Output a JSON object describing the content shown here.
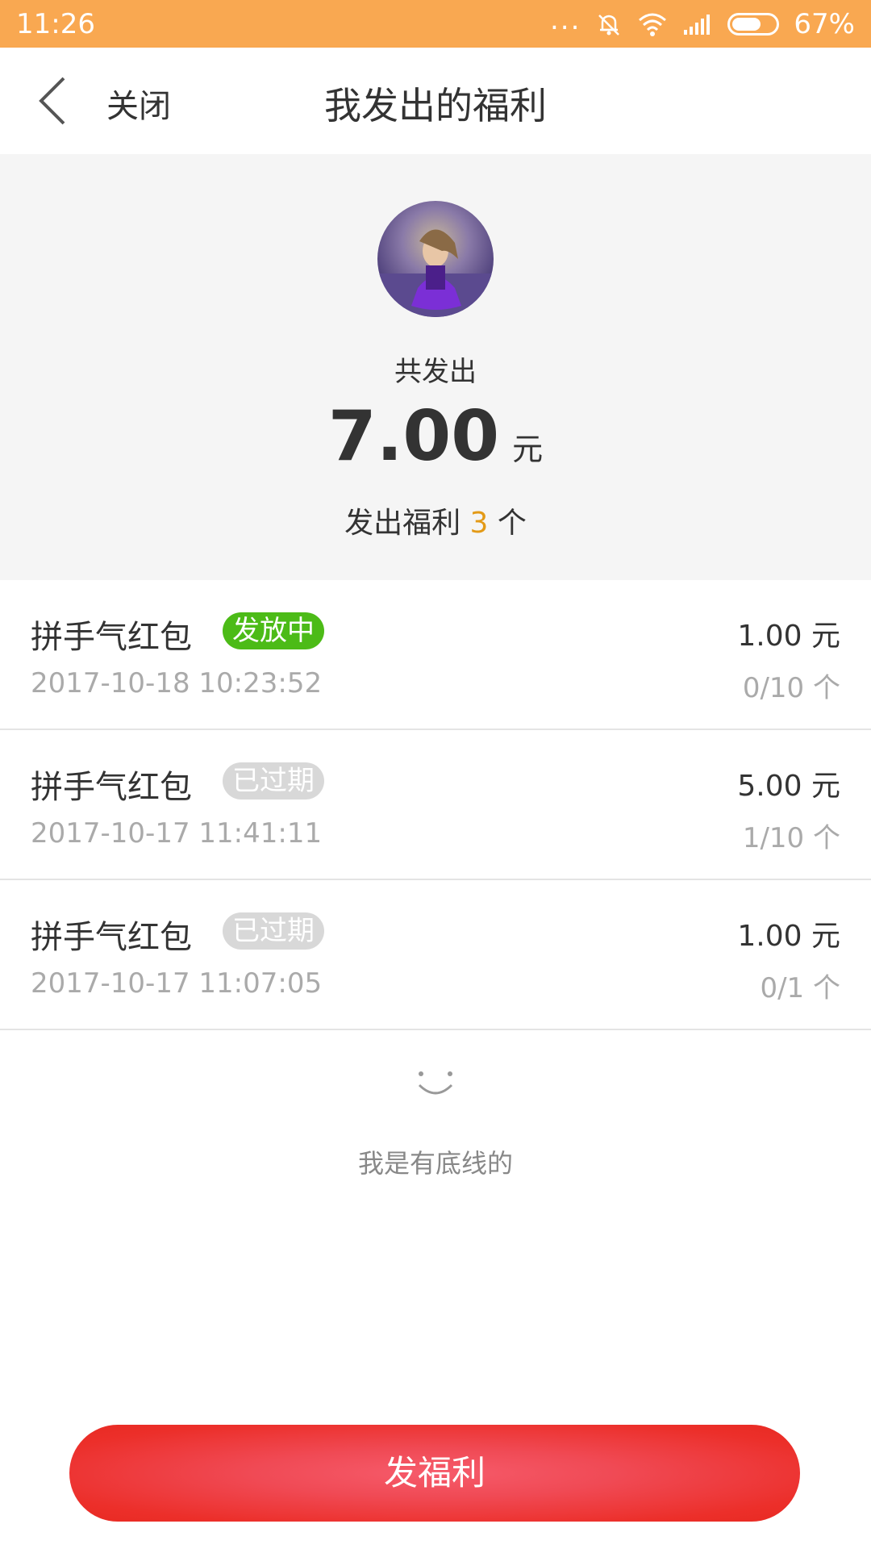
{
  "status_bar": {
    "time": "11:26",
    "signal_dots": "...",
    "battery_percent": "67%",
    "battery_level": 0.67
  },
  "nav": {
    "back_icon": "chevron-left-icon",
    "close_label": "关闭",
    "title": "我发出的福利"
  },
  "summary": {
    "total_label": "共发出",
    "total_amount": "7.00",
    "total_unit": "元",
    "count_prefix": "发出福利 ",
    "count_value": "3",
    "count_suffix": " 个",
    "accent_color": "#e39a17"
  },
  "list": {
    "items": [
      {
        "title": "拼手气红包",
        "status": "发放中",
        "status_type": "active",
        "time": "2017-10-18 10:23:52",
        "amount": "1.00 元",
        "progress": "0/10 个"
      },
      {
        "title": "拼手气红包",
        "status": "已过期",
        "status_type": "expired",
        "time": "2017-10-17 11:41:11",
        "amount": "5.00 元",
        "progress": "1/10 个"
      },
      {
        "title": "拼手气红包",
        "status": "已过期",
        "status_type": "expired",
        "time": "2017-10-17 11:07:05",
        "amount": "1.00 元",
        "progress": "0/1 个"
      }
    ]
  },
  "end": {
    "icon": "smile-icon",
    "text": "我是有底线的"
  },
  "send_button": {
    "label": "发福利",
    "color": "#ec2f2a"
  }
}
